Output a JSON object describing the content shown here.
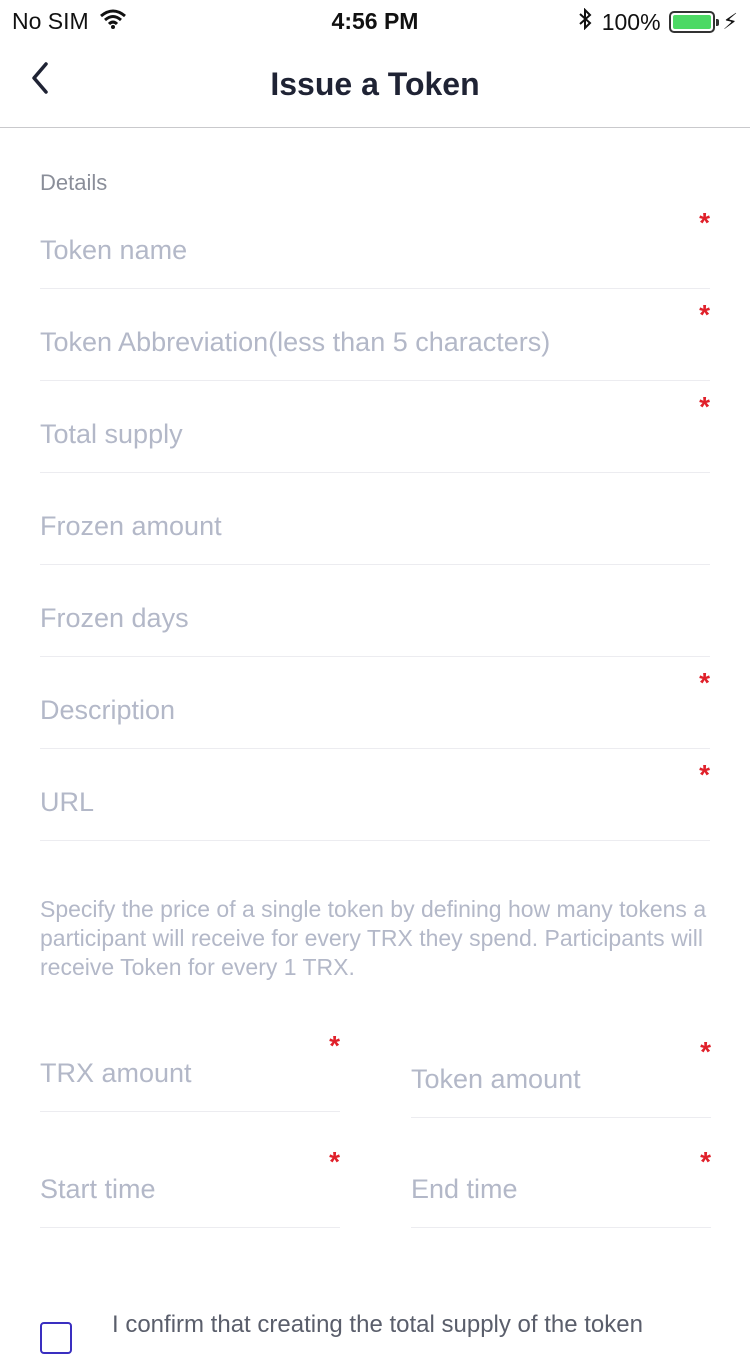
{
  "status": {
    "carrier": "No SIM",
    "time": "4:56 PM",
    "battery_pct": "100%",
    "battery_fill": 1.0
  },
  "nav": {
    "title": "Issue a Token"
  },
  "details_label": "Details",
  "fields": {
    "token_name": {
      "placeholder": "Token name",
      "value": ""
    },
    "token_abbr": {
      "placeholder": "Token Abbreviation(less than 5 characters)",
      "value": ""
    },
    "total_supply": {
      "placeholder": "Total supply",
      "value": ""
    },
    "frozen_amount": {
      "placeholder": "Frozen amount",
      "value": ""
    },
    "frozen_days": {
      "placeholder": "Frozen days",
      "value": ""
    },
    "description": {
      "placeholder": "Description",
      "value": ""
    },
    "url": {
      "placeholder": "URL",
      "value": ""
    },
    "trx_amount": {
      "placeholder": "TRX amount",
      "value": ""
    },
    "token_amount": {
      "placeholder": "Token amount",
      "value": ""
    },
    "start_time": {
      "placeholder": "Start time",
      "value": ""
    },
    "end_time": {
      "placeholder": "End time",
      "value": ""
    }
  },
  "required_marker": "*",
  "info_text": "Specify the price of a single token by defining how many tokens a participant will receive for every TRX they spend. Participants will receive Token for every 1 TRX.",
  "confirm_text": "I confirm that creating the total supply of the token",
  "colors": {
    "required": "#e0202a",
    "placeholder": "#b3b8c8",
    "checkbox_border": "#3a2fc0",
    "battery": "#4cd964"
  }
}
